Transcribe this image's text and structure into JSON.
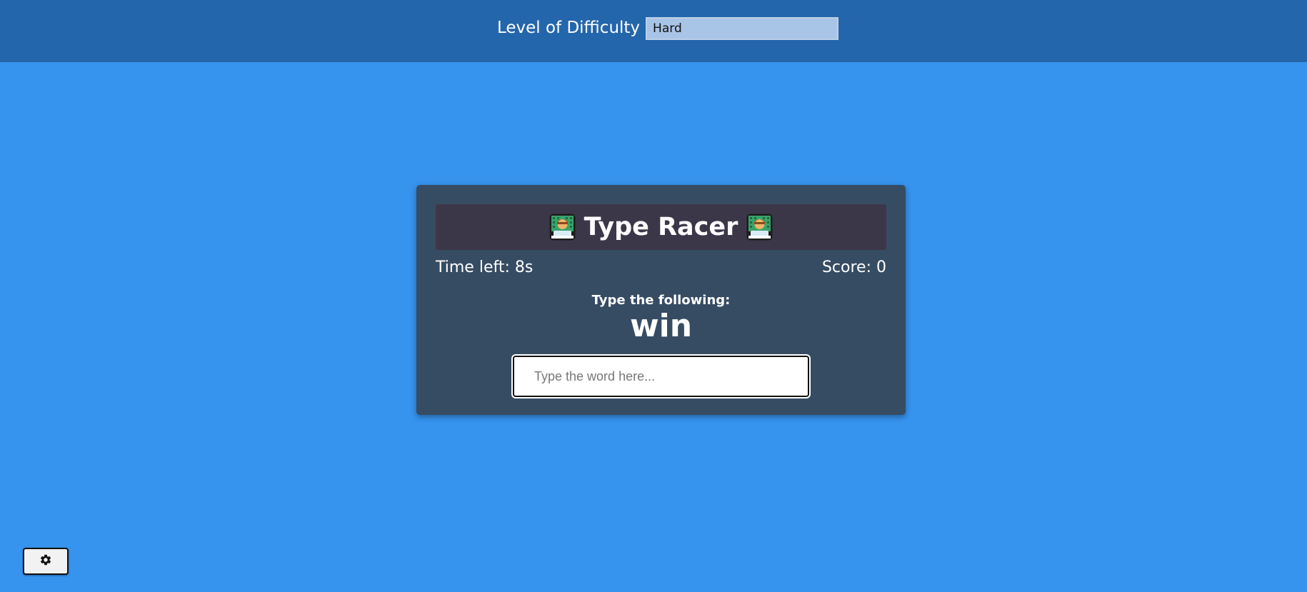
{
  "header": {
    "difficulty_label": "Level of Difficulty",
    "difficulty_selected": "Hard"
  },
  "game": {
    "title": "Type Racer",
    "title_icon": "technologist-emoji-icon",
    "time_left": "Time left: 8s",
    "score": "Score: 0",
    "prompt_label": "Type the following:",
    "target_word": "win",
    "input_placeholder": "Type the word here...",
    "input_value": ""
  },
  "footer": {
    "settings_icon": "gear-icon"
  },
  "colors": {
    "page_background": "#3693ee",
    "topbar_background": "#2466ab",
    "card_background": "#364c63",
    "title_bar_background": "#3c3748"
  }
}
